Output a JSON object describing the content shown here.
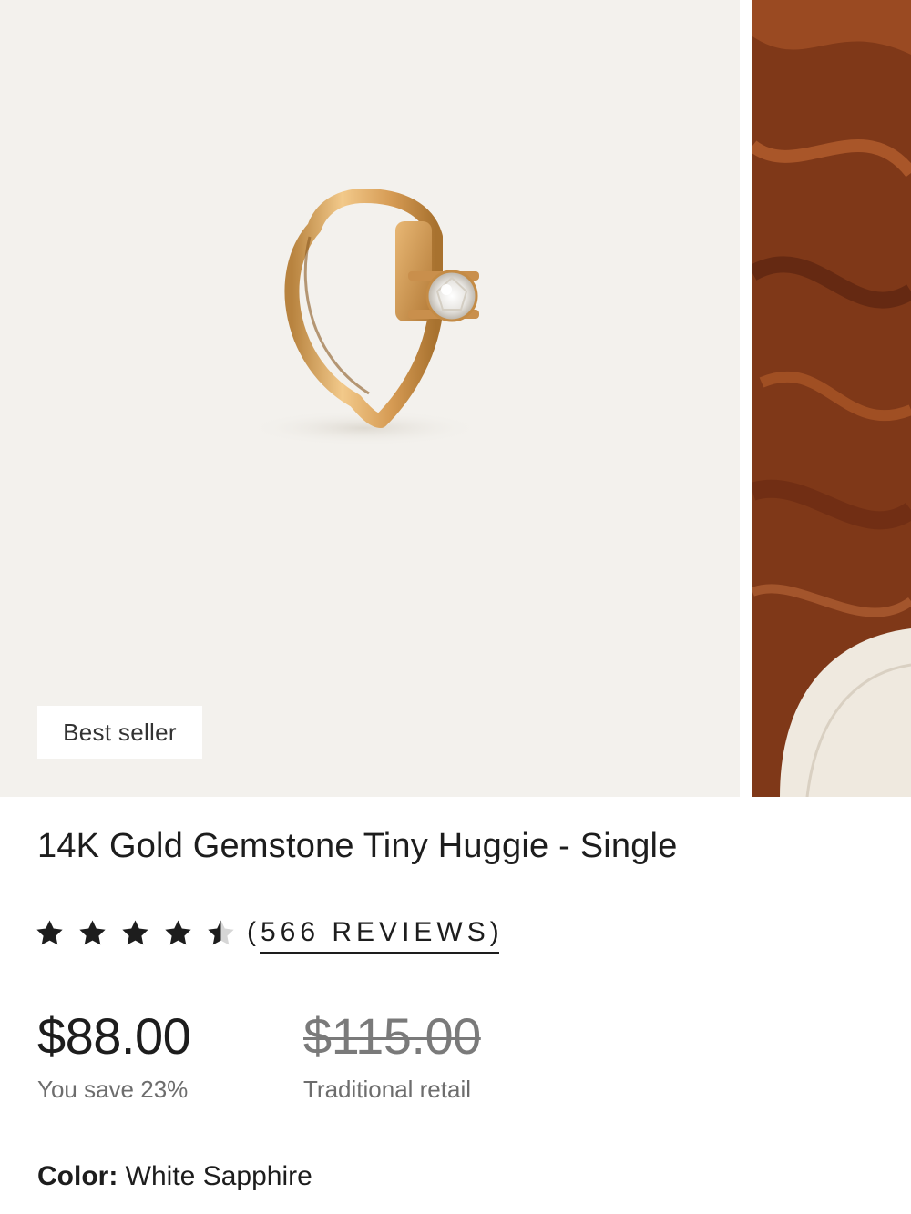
{
  "product": {
    "badge": "Best seller",
    "title": "14K Gold Gemstone Tiny Huggie - Single",
    "rating": 4.5,
    "reviews_label": "(566 REVIEWS)",
    "price": "$88.00",
    "savings": "You save 23%",
    "original_price": "$115.00",
    "original_price_label": "Traditional retail",
    "color_label": "Color:",
    "color_value": "White Sapphire"
  },
  "colors": {
    "background": "#ffffff",
    "image_background": "#f3f1ed",
    "gold": "#d9a25f",
    "text": "#1d1d1d",
    "muted_text": "#6d6d6d"
  },
  "icons": {
    "star": "star-icon",
    "half_star": "star-half-icon"
  }
}
